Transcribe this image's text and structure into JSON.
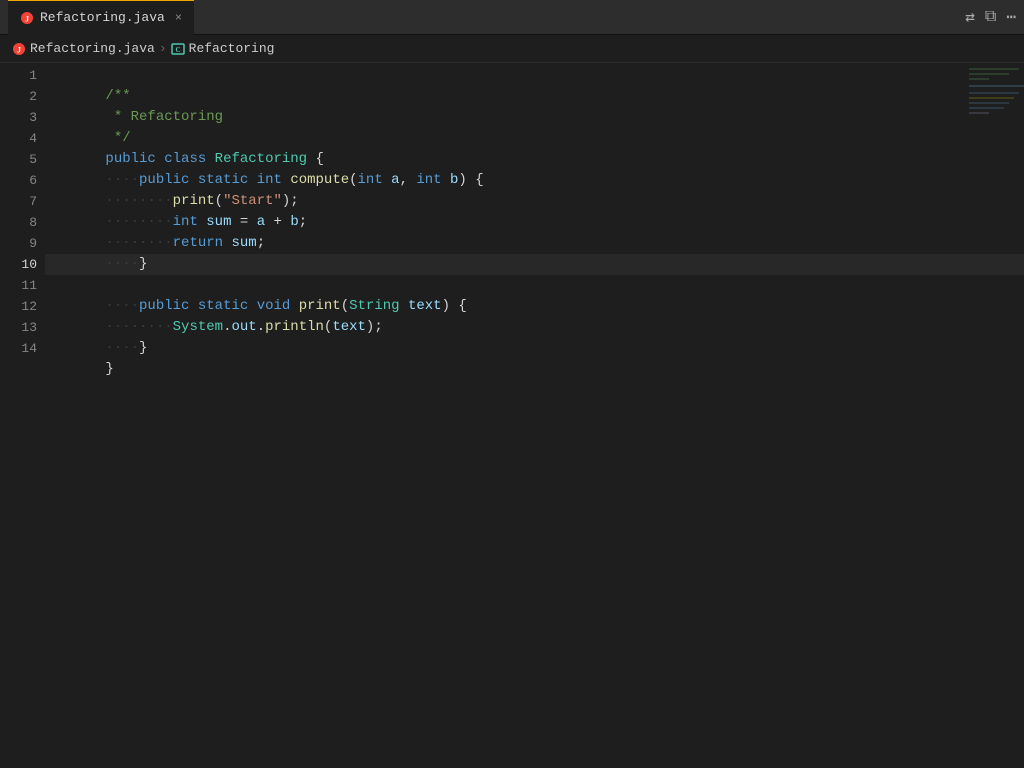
{
  "titlebar": {
    "tab_label": "Refactoring.java",
    "close_label": "×"
  },
  "breadcrumb": {
    "file": "Refactoring.java",
    "separator": "›",
    "class": "Refactoring"
  },
  "toolbar": {
    "update_icon": "⇄",
    "split_icon": "⧉",
    "more_icon": "⋯"
  },
  "lines": [
    {
      "num": 1,
      "active": false
    },
    {
      "num": 2,
      "active": false
    },
    {
      "num": 3,
      "active": false
    },
    {
      "num": 4,
      "active": false
    },
    {
      "num": 5,
      "active": false
    },
    {
      "num": 6,
      "active": false
    },
    {
      "num": 7,
      "active": false
    },
    {
      "num": 8,
      "active": false
    },
    {
      "num": 9,
      "active": false
    },
    {
      "num": 10,
      "active": true
    },
    {
      "num": 11,
      "active": false
    },
    {
      "num": 12,
      "active": false
    },
    {
      "num": 13,
      "active": false
    },
    {
      "num": 14,
      "active": false
    }
  ]
}
